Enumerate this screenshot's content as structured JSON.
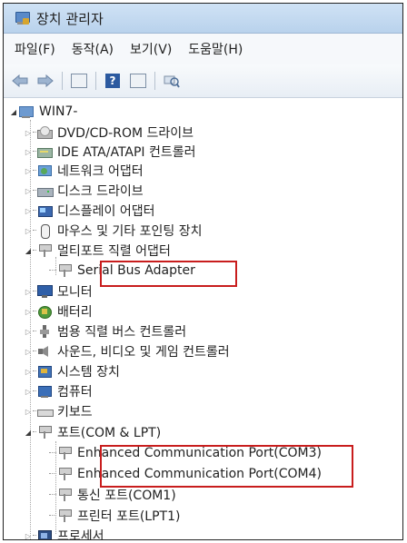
{
  "window": {
    "title": "장치 관리자"
  },
  "menu": [
    "파일(F)",
    "동작(A)",
    "보기(V)",
    "도움말(H)"
  ],
  "toolbar": {
    "back_icon": "back-arrow-icon",
    "forward_icon": "forward-arrow-icon",
    "help_glyph": "?"
  },
  "tree": {
    "root": "WIN7-",
    "items": [
      {
        "label": "DVD/CD-ROM 드라이브",
        "icon": "dvd-drive-icon"
      },
      {
        "label": "IDE ATA/ATAPI 컨트롤러",
        "icon": "ide-controller-icon"
      },
      {
        "label": "네트워크 어댑터",
        "icon": "network-adapter-icon"
      },
      {
        "label": "디스크 드라이브",
        "icon": "disk-drive-icon"
      },
      {
        "label": "디스플레이 어댑터",
        "icon": "display-adapter-icon"
      },
      {
        "label": "마우스 및 기타 포인팅 장치",
        "icon": "mouse-icon"
      },
      {
        "label": "멀티포트 직렬 어댑터",
        "icon": "multiport-serial-icon"
      },
      {
        "label": "Serial Bus Adapter",
        "icon": "serial-port-icon"
      },
      {
        "label": "모니터",
        "icon": "monitor-icon"
      },
      {
        "label": "배터리",
        "icon": "battery-icon"
      },
      {
        "label": "범용 직렬 버스 컨트롤러",
        "icon": "usb-controller-icon"
      },
      {
        "label": "사운드, 비디오 및 게임 컨트롤러",
        "icon": "sound-icon"
      },
      {
        "label": "시스템 장치",
        "icon": "system-devices-icon"
      },
      {
        "label": "컴퓨터",
        "icon": "computer-icon"
      },
      {
        "label": "키보드",
        "icon": "keyboard-icon"
      },
      {
        "label": "포트(COM & LPT)",
        "icon": "ports-icon"
      },
      {
        "label": "Enhanced Communication Port(COM3)",
        "icon": "port-icon"
      },
      {
        "label": "Enhanced Communication Port(COM4)",
        "icon": "port-icon"
      },
      {
        "label": "통신 포트(COM1)",
        "icon": "port-icon"
      },
      {
        "label": "프린터 포트(LPT1)",
        "icon": "port-icon"
      },
      {
        "label": "프로세서",
        "icon": "processor-icon"
      }
    ]
  },
  "colors": {
    "highlight": "#c81d1d",
    "titlebar": "#c4daf0"
  }
}
